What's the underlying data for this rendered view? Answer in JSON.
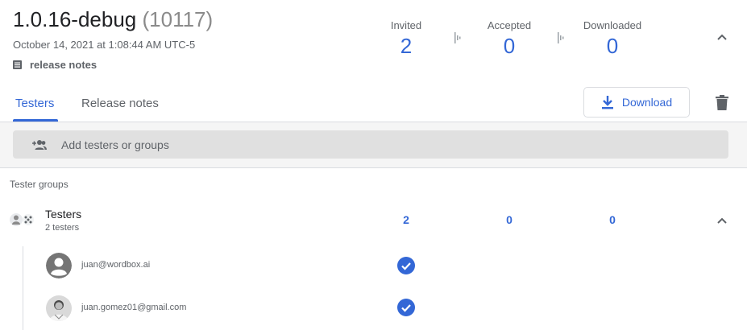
{
  "release": {
    "version": "1.0.16-debug",
    "build": "(10117)",
    "date": "October 14, 2021 at 1:08:44 AM UTC-5",
    "notes_label": "release notes"
  },
  "stats": [
    {
      "label": "Invited",
      "value": "2"
    },
    {
      "label": "Accepted",
      "value": "0"
    },
    {
      "label": "Downloaded",
      "value": "0"
    }
  ],
  "tabs": [
    {
      "label": "Testers",
      "active": true
    },
    {
      "label": "Release notes",
      "active": false
    }
  ],
  "actions": {
    "download_label": "Download"
  },
  "add_testers": {
    "placeholder": "Add testers or groups"
  },
  "groups_section": {
    "title": "Tester groups"
  },
  "group": {
    "name": "Testers",
    "count": "2 testers",
    "invited": "2",
    "accepted": "0",
    "downloaded": "0"
  },
  "testers": [
    {
      "email": "juan@wordbox.ai",
      "invited": true,
      "avatar": "default-person-icon"
    },
    {
      "email": "juan.gomez01@gmail.com",
      "invited": true,
      "avatar": "photo"
    }
  ],
  "colors": {
    "accent": "#3367d6",
    "text": "#202124",
    "muted": "#5f6368",
    "divider": "#dadce0"
  }
}
